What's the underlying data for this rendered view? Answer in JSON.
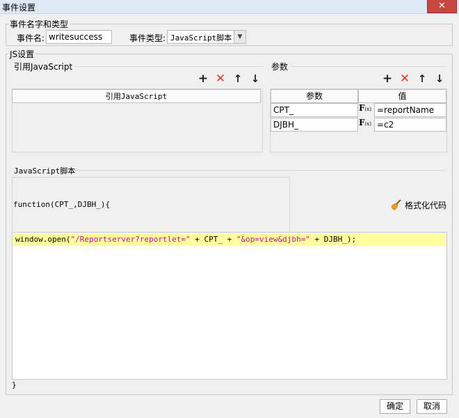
{
  "window": {
    "title": "事件设置",
    "close_glyph": "✕"
  },
  "event_section": {
    "legend": "事件名字和类型",
    "name_label": "事件名:",
    "name_value": "writesuccess",
    "type_label": "事件类型:",
    "type_value": "JavaScript脚本",
    "type_arrow": "▼"
  },
  "js_section": {
    "legend": "JS设置",
    "ref_js": {
      "title": "引用JavaScript",
      "column_header": "引用JavaScript",
      "toolbar": {
        "add": "+",
        "delete": "✕",
        "up": "↑",
        "down": "↓"
      }
    },
    "params": {
      "title": "参数",
      "columns": [
        "参数",
        "值"
      ],
      "rows": [
        {
          "name": "CPT_",
          "fx": "F",
          "fx_sub": "(x)",
          "value": "=reportName"
        },
        {
          "name": "DJBH_",
          "fx": "F",
          "fx_sub": "(x)",
          "value": "=c2"
        }
      ],
      "toolbar": {
        "add": "+",
        "delete": "✕",
        "up": "↑",
        "down": "↓"
      }
    },
    "script": {
      "title": "JavaScript脚本",
      "signature": "function(CPT_,DJBH_){",
      "format_button": "格式化代码",
      "code_parts": {
        "p1": "window.open(",
        "s1": "\"/Reportserver?reportlet=\"",
        "p2": " + CPT_ + ",
        "s2": "\"&op=view&djbh=\"",
        "p3": " + DJBH_);"
      },
      "closing": "}"
    }
  },
  "buttons": {
    "ok": "确定",
    "cancel": "取消"
  },
  "colors": {
    "highlight": "#ffff9e",
    "string": "#c0149b",
    "delete": "#e03a2f",
    "close": "#c7463e"
  }
}
